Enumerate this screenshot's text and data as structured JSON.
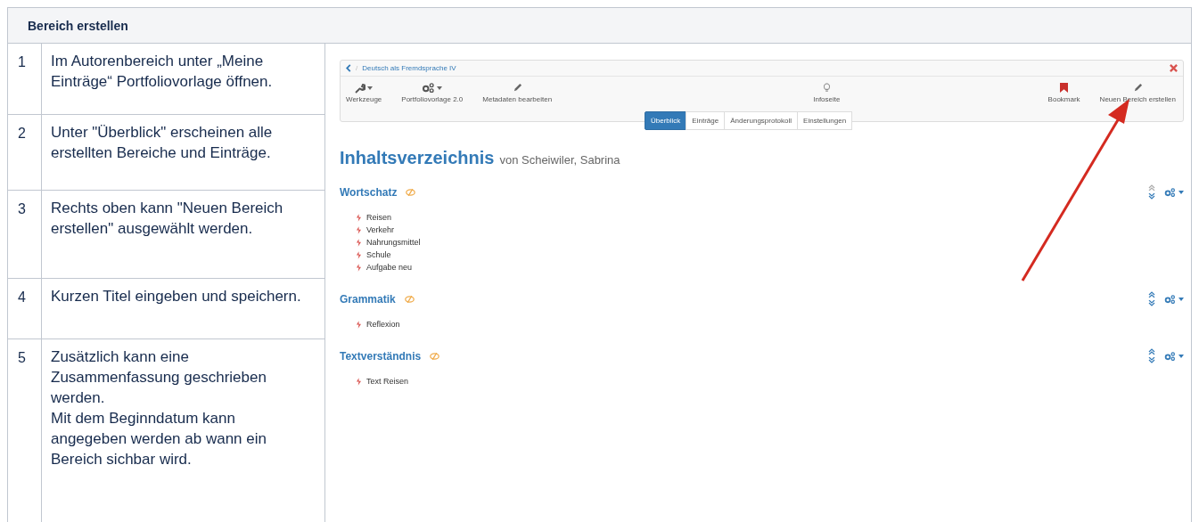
{
  "title": "Bereich erstellen",
  "steps": [
    {
      "number": "1",
      "text": "Im Autorenbereich unter „Meine Einträge“ Portfoliovorlage öffnen."
    },
    {
      "number": "2",
      "text": "Unter \"Überblick\" erscheinen alle erstellten Bereiche und Einträge."
    },
    {
      "number": "3",
      "text": "Rechts oben kann \"Neuen Bereich erstellen\" ausgewählt werden."
    },
    {
      "number": "4",
      "text": "Kurzen Titel eingeben und speichern."
    },
    {
      "number": "5",
      "text": "Zusätzlich kann eine Zusammenfassung geschrieben werden.\nMit dem Beginndatum kann angegeben werden ab wann ein Bereich sichbar wird."
    }
  ],
  "screenshot": {
    "breadcrumb_separator": "/",
    "breadcrumb": "Deutsch als Fremdsprache IV",
    "toolbar_left": [
      {
        "kind": "wrench",
        "label": "Werkzeuge",
        "dropdown": true
      },
      {
        "kind": "gears",
        "label": "Portfoliovorlage 2.0",
        "dropdown": true
      },
      {
        "kind": "pencil",
        "label": "Metadaten bearbeiten",
        "dropdown": false
      }
    ],
    "toolbar_center": [
      {
        "kind": "bulb",
        "label": "Infoseite",
        "dropdown": false
      }
    ],
    "toolbar_right": [
      {
        "kind": "bookmark",
        "label": "Bookmark",
        "dropdown": false
      },
      {
        "kind": "pencil",
        "label": "Neuen Bereich erstellen",
        "dropdown": false
      }
    ],
    "tabs": [
      {
        "label": "Überblick",
        "selected": true
      },
      {
        "label": "Einträge",
        "selected": false
      },
      {
        "label": "Änderungsprotokoll",
        "selected": false
      },
      {
        "label": "Einstellungen",
        "selected": false
      }
    ],
    "heading": "Inhaltsverzeichnis",
    "author": "von Scheiwiler, Sabrina",
    "sections": [
      {
        "title": "Wortschatz",
        "move_up_enabled": false,
        "items": [
          "Reisen",
          "Verkehr",
          "Nahrungsmittel",
          "Schule",
          "Aufgabe neu"
        ]
      },
      {
        "title": "Grammatik",
        "move_up_enabled": true,
        "items": [
          "Reflexion"
        ]
      },
      {
        "title": "Textverständnis",
        "move_up_enabled": true,
        "items": [
          "Text Reisen"
        ]
      }
    ]
  }
}
